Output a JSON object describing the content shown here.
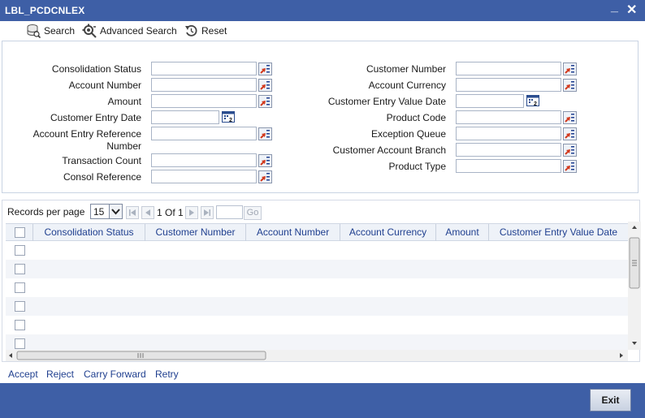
{
  "window": {
    "title": "LBL_PCDCNLEX",
    "minimize": "_",
    "close": "✕"
  },
  "toolbar": {
    "search": "Search",
    "advanced_search": "Advanced Search",
    "reset": "Reset"
  },
  "form": {
    "left": [
      {
        "label": "Consolidation Status",
        "value": ""
      },
      {
        "label": "Account Number",
        "value": ""
      },
      {
        "label": "Amount",
        "value": ""
      },
      {
        "label": "Customer Entry Date",
        "value": ""
      },
      {
        "label": "Account Entry Reference",
        "label2": "Number",
        "value": ""
      },
      {
        "label": "Transaction Count",
        "value": ""
      },
      {
        "label": "Consol Reference",
        "value": ""
      }
    ],
    "right": [
      {
        "label": "Customer Number",
        "value": ""
      },
      {
        "label": "Account Currency",
        "value": ""
      },
      {
        "label": "Customer Entry Value Date",
        "value": ""
      },
      {
        "label": "Product Code",
        "value": ""
      },
      {
        "label": "Exception Queue",
        "value": ""
      },
      {
        "label": "Customer Account Branch",
        "value": ""
      },
      {
        "label": "Product Type",
        "value": ""
      }
    ]
  },
  "pager": {
    "records_label": "Records per page",
    "page_size": "15",
    "page_info": "1 Of 1",
    "go": "Go"
  },
  "grid": {
    "columns": [
      "Consolidation Status",
      "Customer Number",
      "Account Number",
      "Account Currency",
      "Amount",
      "Customer Entry Value Date"
    ],
    "rows": 6
  },
  "actions": [
    "Accept",
    "Reject",
    "Carry Forward",
    "Retry"
  ],
  "footer": {
    "exit": "Exit"
  },
  "colors": {
    "titlebar": "#3e5fa6",
    "link": "#1f3f8f",
    "header_bg": "#eef2f8"
  },
  "icons": {
    "search": "database-search-icon",
    "advanced": "gear-search-icon",
    "reset": "reset-icon",
    "lov": "list-of-values-icon",
    "calendar": "calendar-icon"
  }
}
